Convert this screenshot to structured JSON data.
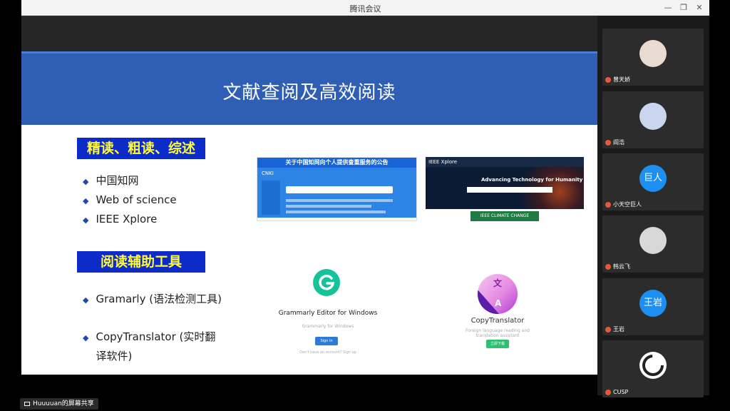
{
  "window": {
    "title": "腾讯会议",
    "controls": {
      "minimize": "—",
      "restore": "❐",
      "close": "✕"
    }
  },
  "slide": {
    "title": "文献查阅及高效阅读",
    "section1": {
      "label": "精读、粗读、综述",
      "items": [
        "中国知网",
        "Web of science",
        "IEEE Xplore"
      ]
    },
    "section2": {
      "label": "阅读辅助工具",
      "items": [
        "Gramarly (语法检测工具)",
        "CopyTranslator (实时翻\n译软件)"
      ]
    },
    "cnki_thumb": {
      "banner": "关于中国知网向个人提供查重服务的公告",
      "logo": "CNKI"
    },
    "ieee_thumb": {
      "bar": "IEEE Xplore",
      "tagline": "Advancing Technology for Humanity",
      "badge": "IEEE CLIMATE CHANGE"
    },
    "grammarly": {
      "name": "Grammarly Editor for Windows",
      "subtitle": "Grammarly for Windows",
      "button": "Sign in",
      "footer": "Don't have an account? Sign up"
    },
    "copytranslator": {
      "logo_top": "文",
      "logo_bottom": "A",
      "name": "CopyTranslator",
      "subtitle": "Foreign language reading and translation assistant",
      "button": "立即下载"
    }
  },
  "participants": [
    {
      "name": "曾天娇",
      "avatar_text": "",
      "avatar_color": "#e8dcd2"
    },
    {
      "name": "阎浩",
      "avatar_text": "",
      "avatar_color": "#c9d6ee"
    },
    {
      "name": "小天空巨人",
      "avatar_text": "巨人",
      "avatar_color": "#1c8ff0"
    },
    {
      "name": "韩云飞",
      "avatar_text": "",
      "avatar_color": "#d8d8d8"
    },
    {
      "name": "王岩",
      "avatar_text": "王岩",
      "avatar_color": "#1c8ff0"
    },
    {
      "name": "CUSP",
      "avatar_text": "",
      "avatar_color": "#ffffff"
    }
  ],
  "share_label": "Huuuuan的屏幕共享"
}
